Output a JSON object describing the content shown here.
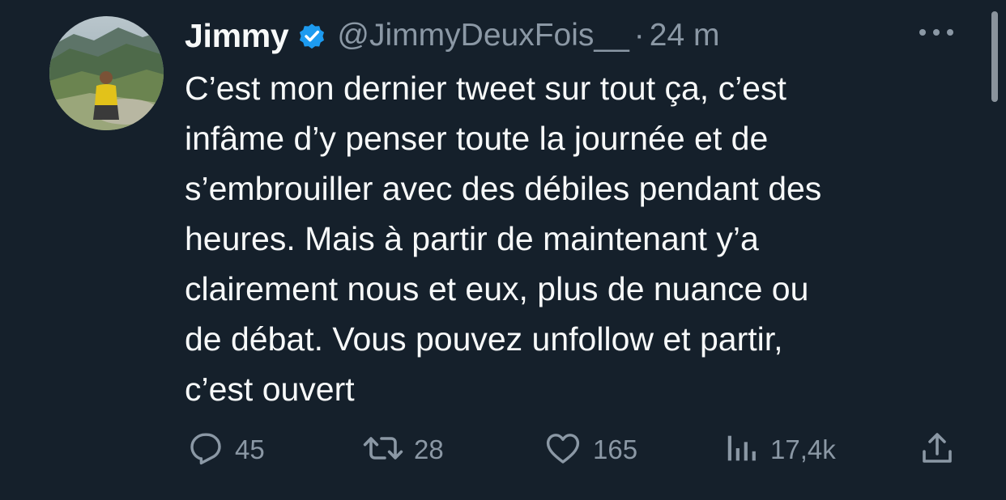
{
  "author": {
    "display_name": "Jimmy",
    "handle": "@JimmyDeuxFois__",
    "separator": "·",
    "time_ago": "24 m",
    "verified_color": "#1d9bf0"
  },
  "tweet": {
    "text": "C’est mon dernier tweet sur tout ça, c’est\ninfâme d’y penser toute la journée et de\ns’embrouiller avec des débiles pendant des\nheures. Mais à partir de maintenant y’a\nclairement nous et eux, plus de nuance ou\nde débat. Vous pouvez unfollow et partir,\nc’est ouvert"
  },
  "actions": {
    "replies": "45",
    "retweets": "28",
    "likes": "165",
    "views": "17,4k"
  },
  "icons": {
    "more": "more-horizontal-icon",
    "reply": "reply-icon",
    "retweet": "retweet-icon",
    "like": "heart-icon",
    "views": "views-chart-icon",
    "share": "share-icon",
    "verified": "verified-badge-icon"
  },
  "colors": {
    "background": "#15202b",
    "text_primary": "#f7f9f9",
    "text_secondary": "#8b98a5"
  }
}
